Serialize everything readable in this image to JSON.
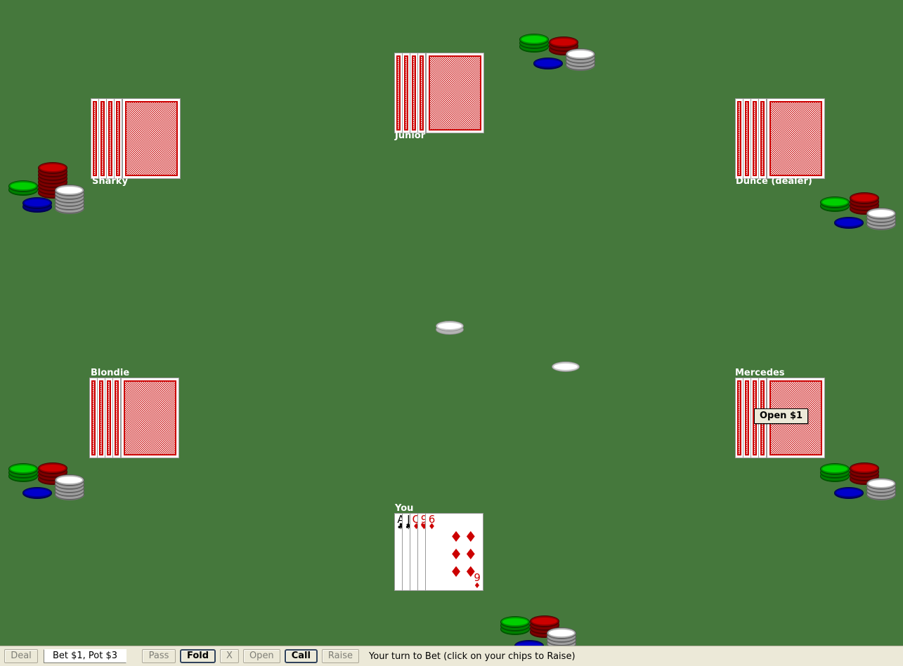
{
  "table": {
    "felt_color": "#45783c",
    "pot_label": "Pot $3"
  },
  "players": [
    {
      "id": "sharky",
      "name": "Sharky",
      "label": "Sharky",
      "cards_face_down": 5,
      "chips": [
        {
          "color": "#00d000",
          "count": 2
        },
        {
          "color": "#cc0000",
          "count": 8
        },
        {
          "color": "#0000cc",
          "count": 2
        },
        {
          "color": "#ffffff",
          "count": 6
        }
      ]
    },
    {
      "id": "junior",
      "name": "Junior",
      "label": "Junior",
      "cards_face_down": 5,
      "chips": [
        {
          "color": "#00d000",
          "count": 3
        },
        {
          "color": "#cc0000",
          "count": 3
        },
        {
          "color": "#0000cc",
          "count": 1
        },
        {
          "color": "#ffffff",
          "count": 4
        }
      ]
    },
    {
      "id": "dunce",
      "name": "Dunce",
      "label": "Dunce (dealer)",
      "is_dealer": true,
      "cards_face_down": 5,
      "chips": [
        {
          "color": "#00d000",
          "count": 2
        },
        {
          "color": "#cc0000",
          "count": 4
        },
        {
          "color": "#0000cc",
          "count": 1
        },
        {
          "color": "#ffffff",
          "count": 4
        }
      ]
    },
    {
      "id": "mercedes",
      "name": "Mercedes",
      "label": "Mercedes",
      "cards_face_down": 5,
      "action_tooltip": "Open $1",
      "chips": [
        {
          "color": "#00d000",
          "count": 3
        },
        {
          "color": "#cc0000",
          "count": 4
        },
        {
          "color": "#0000cc",
          "count": 1
        },
        {
          "color": "#ffffff",
          "count": 4
        }
      ]
    },
    {
      "id": "blondie",
      "name": "Blondie",
      "label": "Blondie",
      "cards_face_down": 5,
      "chips": [
        {
          "color": "#00d000",
          "count": 3
        },
        {
          "color": "#cc0000",
          "count": 4
        },
        {
          "color": "#0000cc",
          "count": 1
        },
        {
          "color": "#ffffff",
          "count": 5
        }
      ]
    },
    {
      "id": "you",
      "name": "You",
      "label": "You",
      "hand": [
        {
          "rank": "A",
          "suit": "♣",
          "color": "black"
        },
        {
          "rank": "J",
          "suit": "♠",
          "color": "black"
        },
        {
          "rank": "Q",
          "suit": "♦",
          "color": "red"
        },
        {
          "rank": "9",
          "suit": "♥",
          "color": "red"
        },
        {
          "rank": "6",
          "suit": "♦",
          "color": "red"
        }
      ],
      "chips": [
        {
          "color": "#00d000",
          "count": 3
        },
        {
          "color": "#cc0000",
          "count": 4
        },
        {
          "color": "#0000cc",
          "count": 1
        },
        {
          "color": "#ffffff",
          "count": 5
        }
      ]
    }
  ],
  "pot_chips": [
    {
      "color": "#ffffff",
      "count": 2
    },
    {
      "color": "#ffffff",
      "count": 1
    }
  ],
  "toolbar": {
    "deal_label": "Deal",
    "bet_field_value": "Bet $1, Pot $3",
    "pass_label": "Pass",
    "fold_label": "Fold",
    "x_label": "X",
    "open_label": "Open",
    "call_label": "Call",
    "raise_label": "Raise",
    "status": "Your turn to Bet (click on your chips to Raise)"
  }
}
